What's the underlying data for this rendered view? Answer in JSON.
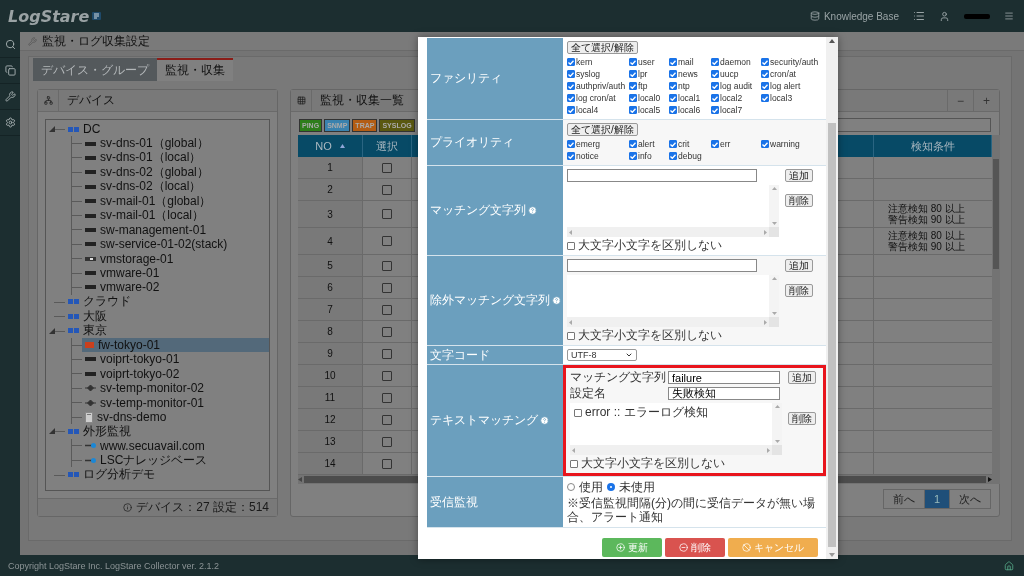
{
  "header": {
    "logo": "LogStare",
    "knowledge_base": "Knowledge Base"
  },
  "breadcrumb": "監視・ログ収集設定",
  "tabs": [
    {
      "label": "デバイス・グループ",
      "selected": false
    },
    {
      "label": "監視・収集",
      "selected": true
    }
  ],
  "device_panel": {
    "title": "デバイス",
    "footer": "デバイス：27 設定：514",
    "tree": [
      {
        "label": "DC",
        "kind": "group",
        "expanded": true,
        "selected": false,
        "children": [
          {
            "label": "sv-dns-01（global）",
            "kind": "server",
            "selected": false
          },
          {
            "label": "sv-dns-01（local）",
            "kind": "server",
            "selected": false
          },
          {
            "label": "sv-dns-02（global）",
            "kind": "server",
            "selected": false
          },
          {
            "label": "sv-dns-02（local）",
            "kind": "server",
            "selected": false
          },
          {
            "label": "sv-mail-01（global）",
            "kind": "server",
            "selected": false
          },
          {
            "label": "sv-mail-01（local）",
            "kind": "server",
            "selected": false
          },
          {
            "label": "sw-management-01",
            "kind": "server",
            "selected": false
          },
          {
            "label": "sw-service-01-02(stack)",
            "kind": "server",
            "selected": false
          },
          {
            "label": "vmstorage-01",
            "kind": "storage",
            "selected": false
          },
          {
            "label": "vmware-01",
            "kind": "server",
            "selected": false
          },
          {
            "label": "vmware-02",
            "kind": "server",
            "selected": false
          }
        ]
      },
      {
        "label": "クラウド",
        "kind": "group",
        "expanded": false,
        "selected": false
      },
      {
        "label": "大阪",
        "kind": "group",
        "expanded": false,
        "selected": false
      },
      {
        "label": "東京",
        "kind": "group",
        "expanded": true,
        "selected": false,
        "children": [
          {
            "label": "fw-tokyo-01",
            "kind": "firewall",
            "selected": true
          },
          {
            "label": "voiprt-tokyo-01",
            "kind": "server",
            "selected": false
          },
          {
            "label": "voiprt-tokyo-02",
            "kind": "server",
            "selected": false
          },
          {
            "label": "sv-temp-monitor-02",
            "kind": "sensor",
            "selected": false
          },
          {
            "label": "sv-temp-monitor-01",
            "kind": "sensor",
            "selected": false
          },
          {
            "label": "sv-dns-demo",
            "kind": "tower",
            "selected": false
          }
        ]
      },
      {
        "label": "外形監視",
        "kind": "group",
        "expanded": true,
        "selected": false,
        "children": [
          {
            "label": "www.secuavail.com",
            "kind": "link",
            "selected": false
          },
          {
            "label": "LSCナレッジベース",
            "kind": "link",
            "selected": false
          }
        ]
      },
      {
        "label": "ログ分析デモ",
        "kind": "group",
        "expanded": false,
        "selected": false
      }
    ]
  },
  "monitor_panel": {
    "title": "監視・収集一覧",
    "collapse": "−",
    "expand": "+",
    "filters": [
      {
        "label": "PING",
        "color": "#2e7d1a"
      },
      {
        "label": "SNMP",
        "color": "#3a82ae"
      },
      {
        "label": "TRAP",
        "color": "#b35d14"
      },
      {
        "label": "SYSLOG",
        "color": "#5a5810"
      }
    ],
    "columns": {
      "no": "NO",
      "select": "選択",
      "condition": "検知条件"
    },
    "rows": [
      {
        "no": "1",
        "checked": false
      },
      {
        "no": "2",
        "checked": false
      },
      {
        "no": "3",
        "checked": false,
        "condition": [
          "注意検知 80 以上",
          "警告検知 90 以上"
        ]
      },
      {
        "no": "4",
        "checked": false,
        "condition": [
          "注意検知 80 以上",
          "警告検知 90 以上"
        ]
      },
      {
        "no": "5",
        "checked": false
      },
      {
        "no": "6",
        "checked": false
      },
      {
        "no": "7",
        "checked": false
      },
      {
        "no": "8",
        "checked": false
      },
      {
        "no": "9",
        "checked": false
      },
      {
        "no": "10",
        "checked": false
      },
      {
        "no": "11",
        "checked": false
      },
      {
        "no": "12",
        "checked": false
      },
      {
        "no": "13",
        "checked": false
      },
      {
        "no": "14",
        "checked": false
      }
    ],
    "pagination": {
      "prev": "前へ",
      "next": "次へ",
      "pages": [
        {
          "label": "1",
          "selected": true
        }
      ]
    }
  },
  "dialog": {
    "rows": [
      {
        "kind": "checkgrid",
        "label": "ファシリティ",
        "toggle": "全て選択/解除",
        "options": [
          {
            "label": "kern",
            "checked": true
          },
          {
            "label": "user",
            "checked": true
          },
          {
            "label": "mail",
            "checked": true
          },
          {
            "label": "daemon",
            "checked": true
          },
          {
            "label": "security/auth",
            "checked": true
          },
          {
            "label": "syslog",
            "checked": true
          },
          {
            "label": "lpr",
            "checked": true
          },
          {
            "label": "news",
            "checked": true
          },
          {
            "label": "uucp",
            "checked": true
          },
          {
            "label": "cron/at",
            "checked": true
          },
          {
            "label": "authpriv/auth",
            "checked": true
          },
          {
            "label": "ftp",
            "checked": true
          },
          {
            "label": "ntp",
            "checked": true
          },
          {
            "label": "log audit",
            "checked": true
          },
          {
            "label": "log alert",
            "checked": true
          },
          {
            "label": "log cron/at",
            "checked": true
          },
          {
            "label": "local0",
            "checked": true
          },
          {
            "label": "local1",
            "checked": true
          },
          {
            "label": "local2",
            "checked": true
          },
          {
            "label": "local3",
            "checked": true
          },
          {
            "label": "local4",
            "checked": true
          },
          {
            "label": "local5",
            "checked": true
          },
          {
            "label": "local6",
            "checked": true
          },
          {
            "label": "local7",
            "checked": true
          }
        ]
      },
      {
        "kind": "checkgrid",
        "label": "プライオリティ",
        "toggle": "全て選択/解除",
        "options": [
          {
            "label": "emerg",
            "checked": true
          },
          {
            "label": "alert",
            "checked": true
          },
          {
            "label": "crit",
            "checked": true
          },
          {
            "label": "err",
            "checked": true
          },
          {
            "label": "warning",
            "checked": true
          },
          {
            "label": "notice",
            "checked": true
          },
          {
            "label": "info",
            "checked": true
          },
          {
            "label": "debug",
            "checked": true
          }
        ]
      },
      {
        "kind": "stringlist",
        "label": "マッチング文字列",
        "help": true,
        "add": "追加",
        "remove": "削除",
        "case_option": {
          "label": "大文字小文字を区別しない",
          "checked": false
        }
      },
      {
        "kind": "stringlist",
        "label": "除外マッチング文字列",
        "help": true,
        "add": "追加",
        "remove": "削除",
        "case_option": {
          "label": "大文字小文字を区別しない",
          "checked": false
        }
      },
      {
        "kind": "select",
        "label": "文字コード",
        "value": "UTF-8"
      },
      {
        "kind": "textmatch",
        "label": "テキストマッチング",
        "help": true,
        "highlighted": true,
        "fields": [
          {
            "label": "マッチング文字列",
            "value": "failure"
          },
          {
            "label": "設定名",
            "value": "失敗検知"
          }
        ],
        "add": "追加",
        "remove": "削除",
        "items": [
          {
            "label": "error :: エラーログ検知",
            "checked": false
          }
        ],
        "case_option": {
          "label": "大文字小文字を区別しない",
          "checked": false
        }
      },
      {
        "kind": "radio",
        "label": "受信監視",
        "options": [
          {
            "label": "使用",
            "selected": false
          },
          {
            "label": "未使用",
            "selected": true
          }
        ],
        "note": "※受信監視間隔(分)の間に受信データが無い場合、アラート通知"
      }
    ],
    "buttons": [
      {
        "label": "更新",
        "kind": "update"
      },
      {
        "label": "削除",
        "kind": "delete"
      },
      {
        "label": "キャンセル",
        "kind": "cancel"
      }
    ]
  },
  "footer": "Copyright LogStare Inc. LogStare Collector ver. 2.1.2"
}
